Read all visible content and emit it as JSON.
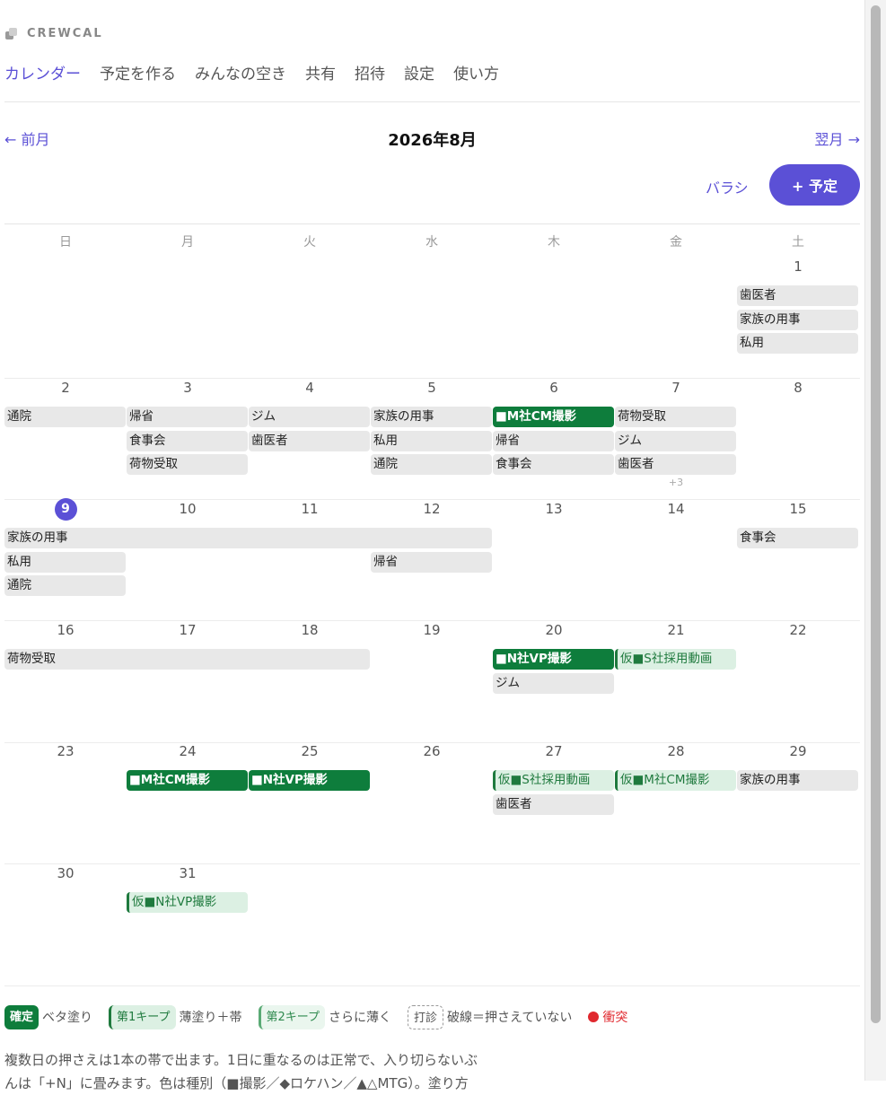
{
  "app": {
    "logo_text": "CREWCAL"
  },
  "nav": {
    "items": [
      "カレンダー",
      "予定を作る",
      "みんなの空き",
      "共有",
      "招待",
      "設定",
      "使い方"
    ]
  },
  "month": {
    "prev": "← 前月",
    "title": "2026年8月",
    "next": "翌月 →"
  },
  "toolbar": {
    "toggle_label": "バラシ",
    "add_label": "+ 予定"
  },
  "weekdays": [
    "日",
    "月",
    "火",
    "水",
    "木",
    "金",
    "土"
  ],
  "weeks": [
    {
      "days": [
        "",
        "",
        "",
        "",
        "",
        "",
        "1"
      ],
      "today_col": -1,
      "events": [
        {
          "col": 6,
          "span": 1,
          "row": 0,
          "label": "歯医者",
          "kind": "gray"
        },
        {
          "col": 6,
          "span": 1,
          "row": 1,
          "label": "家族の用事",
          "kind": "gray"
        },
        {
          "col": 6,
          "span": 1,
          "row": 2,
          "label": "私用",
          "kind": "gray"
        }
      ],
      "more": []
    },
    {
      "days": [
        "2",
        "3",
        "4",
        "5",
        "6",
        "7",
        "8"
      ],
      "today_col": -1,
      "events": [
        {
          "col": 0,
          "span": 1,
          "row": 0,
          "label": "通院",
          "kind": "gray"
        },
        {
          "col": 1,
          "span": 1,
          "row": 0,
          "label": "帰省",
          "kind": "gray"
        },
        {
          "col": 1,
          "span": 1,
          "row": 1,
          "label": "食事会",
          "kind": "gray"
        },
        {
          "col": 1,
          "span": 1,
          "row": 2,
          "label": "荷物受取",
          "kind": "gray"
        },
        {
          "col": 2,
          "span": 1,
          "row": 0,
          "label": "ジム",
          "kind": "gray"
        },
        {
          "col": 2,
          "span": 1,
          "row": 1,
          "label": "歯医者",
          "kind": "gray"
        },
        {
          "col": 3,
          "span": 1,
          "row": 0,
          "label": "家族の用事",
          "kind": "gray"
        },
        {
          "col": 3,
          "span": 1,
          "row": 1,
          "label": "私用",
          "kind": "gray"
        },
        {
          "col": 3,
          "span": 1,
          "row": 2,
          "label": "通院",
          "kind": "gray"
        },
        {
          "col": 4,
          "span": 1,
          "row": 0,
          "label": "■M社CM撮影",
          "kind": "conf"
        },
        {
          "col": 4,
          "span": 1,
          "row": 1,
          "label": "帰省",
          "kind": "gray"
        },
        {
          "col": 4,
          "span": 1,
          "row": 2,
          "label": "食事会",
          "kind": "gray"
        },
        {
          "col": 5,
          "span": 1,
          "row": 0,
          "label": "荷物受取",
          "kind": "gray"
        },
        {
          "col": 5,
          "span": 1,
          "row": 1,
          "label": "ジム",
          "kind": "gray"
        },
        {
          "col": 5,
          "span": 1,
          "row": 2,
          "label": "歯医者",
          "kind": "gray"
        }
      ],
      "more": [
        {
          "col": 5,
          "label": "+3"
        }
      ]
    },
    {
      "days": [
        "9",
        "10",
        "11",
        "12",
        "13",
        "14",
        "15"
      ],
      "today_col": 0,
      "events": [
        {
          "col": 0,
          "span": 4,
          "row": 0,
          "label": "家族の用事",
          "kind": "gray"
        },
        {
          "col": 6,
          "span": 1,
          "row": 0,
          "label": "食事会",
          "kind": "gray"
        },
        {
          "col": 0,
          "span": 1,
          "row": 1,
          "label": "私用",
          "kind": "gray"
        },
        {
          "col": 3,
          "span": 1,
          "row": 1,
          "label": "帰省",
          "kind": "gray"
        },
        {
          "col": 0,
          "span": 1,
          "row": 2,
          "label": "通院",
          "kind": "gray"
        }
      ],
      "more": []
    },
    {
      "days": [
        "16",
        "17",
        "18",
        "19",
        "20",
        "21",
        "22"
      ],
      "today_col": -1,
      "events": [
        {
          "col": 0,
          "span": 3,
          "row": 0,
          "label": "荷物受取",
          "kind": "gray"
        },
        {
          "col": 4,
          "span": 1,
          "row": 0,
          "label": "■N社VP撮影",
          "kind": "conf"
        },
        {
          "col": 5,
          "span": 1,
          "row": 0,
          "label": "仮■S社採用動画",
          "kind": "keep"
        },
        {
          "col": 4,
          "span": 1,
          "row": 1,
          "label": "ジム",
          "kind": "gray"
        }
      ],
      "more": []
    },
    {
      "days": [
        "23",
        "24",
        "25",
        "26",
        "27",
        "28",
        "29"
      ],
      "today_col": -1,
      "events": [
        {
          "col": 1,
          "span": 1,
          "row": 0,
          "label": "■M社CM撮影",
          "kind": "conf"
        },
        {
          "col": 2,
          "span": 1,
          "row": 0,
          "label": "■N社VP撮影",
          "kind": "conf"
        },
        {
          "col": 4,
          "span": 1,
          "row": 0,
          "label": "仮■S社採用動画",
          "kind": "keep"
        },
        {
          "col": 5,
          "span": 1,
          "row": 0,
          "label": "仮■M社CM撮影",
          "kind": "keep"
        },
        {
          "col": 6,
          "span": 1,
          "row": 0,
          "label": "家族の用事",
          "kind": "gray"
        },
        {
          "col": 4,
          "span": 1,
          "row": 1,
          "label": "歯医者",
          "kind": "gray"
        }
      ],
      "more": []
    },
    {
      "days": [
        "30",
        "31",
        "",
        "",
        "",
        "",
        ""
      ],
      "today_col": -1,
      "events": [
        {
          "col": 1,
          "span": 1,
          "row": 0,
          "label": "仮■N社VP撮影",
          "kind": "keep"
        }
      ],
      "more": []
    }
  ],
  "legend": {
    "confirmed": "確定",
    "confirmed_desc": "ベタ塗り",
    "keep1": "第1キープ",
    "keep1_desc": "薄塗り＋帯",
    "keep2": "第2キープ",
    "keep2_desc": "さらに薄く",
    "tentative": "打診",
    "tentative_desc": "破線＝押さえていない",
    "conflict": "衝突"
  },
  "note": {
    "line1": "複数日の押さえは1本の帯で出ます。1日に重なるのは正常で、入り切らないぶ",
    "line2": "んは「+N」に畳みます。色は種別（■撮影／◆ロケハン／▲△MTG）。塗り方"
  },
  "colors": {
    "accent": "#5b50d6",
    "confirmed": "#0e7d3c",
    "keep": "#dcf0e3",
    "conflict": "#e0282e"
  }
}
